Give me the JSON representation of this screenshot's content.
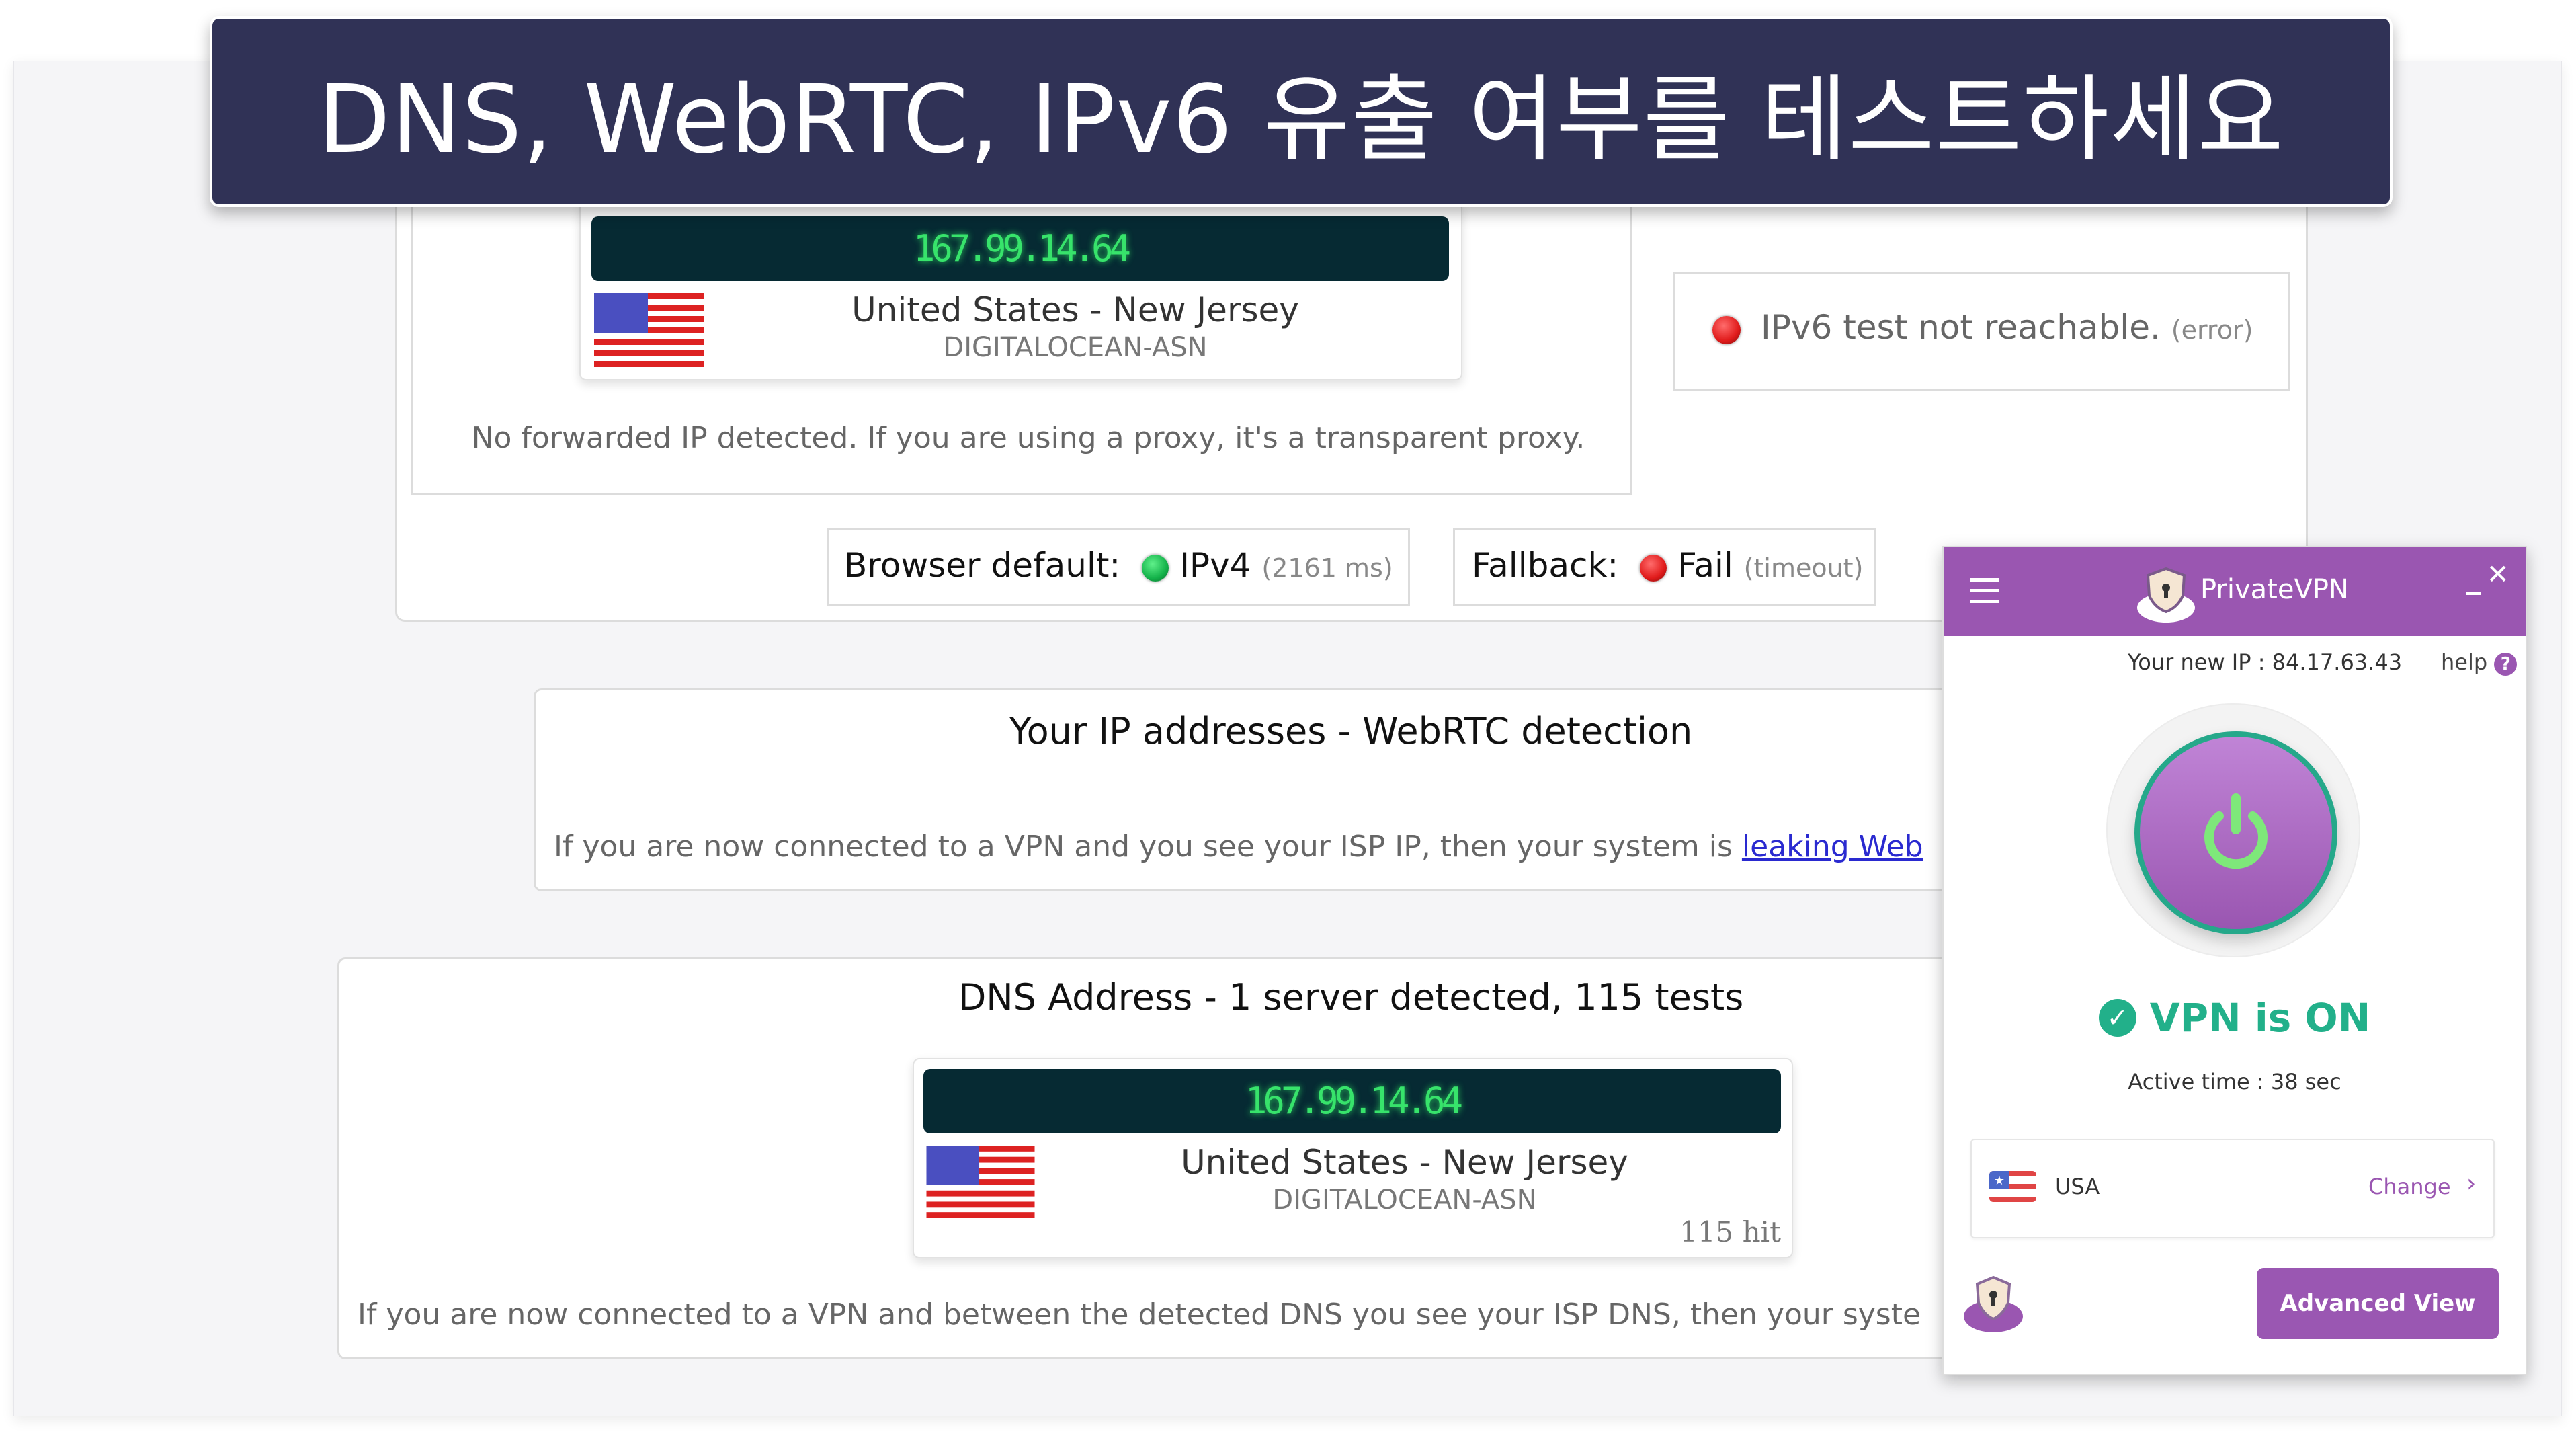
{
  "banner": {
    "title": "DNS, WebRTC, IPv6 유출 여부를 테스트하세요"
  },
  "ip_section": {
    "ip": "167.99.14.64",
    "location": "United States - New Jersey",
    "asn": "DIGITALOCEAN-ASN",
    "forwarded_note": "No forwarded IP detected. If you are using a proxy, it's a transparent proxy.",
    "ipv6_status": "IPv6 test not reachable.",
    "ipv6_status_detail": "(error)",
    "browser_default_label": "Browser default:",
    "browser_default_value": "IPv4",
    "browser_default_detail": "(2161 ms)",
    "fallback_label": "Fallback:",
    "fallback_value": "Fail",
    "fallback_detail": "(timeout)"
  },
  "webrtc_section": {
    "title": "Your IP addresses - WebRTC detection",
    "note": "If you are now connected to a VPN and you see your ISP IP, then your system is ",
    "link_text": "leaking Web"
  },
  "dns_section": {
    "title": "DNS Address - 1 server detected, 115 tests",
    "ip": "167.99.14.64",
    "location": "United States - New Jersey",
    "asn": "DIGITALOCEAN-ASN",
    "hits": "115 hit",
    "note": "If you are now connected to a VPN and between the detected DNS you see your ISP DNS, then your syste"
  },
  "vpn_app": {
    "app_name": "PrivateVPN",
    "new_ip_label": "Your new IP : 84.17.63.43",
    "help_label": "help",
    "status": "VPN is ON",
    "active_time": "Active time :  38 sec",
    "country": "USA",
    "change_label": "Change",
    "advanced_view_label": "Advanced View",
    "colors": {
      "brand": "#9a56b1",
      "status": "#22b08a",
      "power": "#7ee87a"
    }
  }
}
